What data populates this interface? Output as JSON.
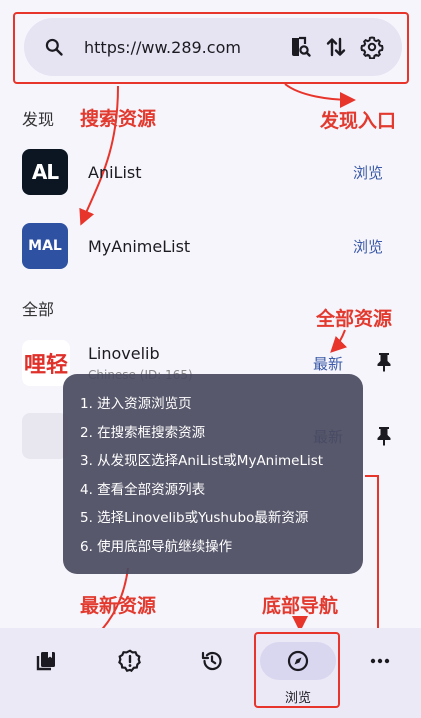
{
  "search": {
    "url": "https://ww.289.com"
  },
  "annotations": {
    "search_sources": "搜索资源",
    "discover_entry": "发现入口",
    "all_sources": "全部资源",
    "latest_sources": "最新资源",
    "bottom_nav": "底部导航"
  },
  "sections": {
    "discover": "发现",
    "all": "全部"
  },
  "discover_items": [
    {
      "name": "AniList",
      "action": "浏览",
      "logo_text": "AL",
      "icon": "anilist-logo"
    },
    {
      "name": "MyAnimeList",
      "action": "浏览",
      "logo_text": "MAL",
      "icon": "myanimelist-logo"
    }
  ],
  "all_items": [
    {
      "name": "Linovelib",
      "subtitle": "Chinese (ID: 165)",
      "action": "最新",
      "logo_text": "哩",
      "logo_text2": "轻",
      "icon": "linovelib-logo"
    },
    {
      "name": "",
      "action": "最新"
    }
  ],
  "popup": {
    "steps": [
      "1. 进入资源浏览页",
      "2. 在搜索框搜索资源",
      "3. 从发现区选择AniList或MyAnimeList",
      "4. 查看全部资源列表",
      "5. 选择Linovelib或Yushubo最新资源",
      "6. 使用底部导航继续操作"
    ]
  },
  "bottom_nav": {
    "browse_label": "浏览",
    "icons": [
      "library-icon",
      "updates-icon",
      "history-icon",
      "compass-icon",
      "more-icon"
    ]
  },
  "colors": {
    "accent": "#3a5aa8",
    "annotation_red": "#e23a2e",
    "anilist_bg": "#0b1622",
    "mal_bg": "#2e51a2"
  }
}
